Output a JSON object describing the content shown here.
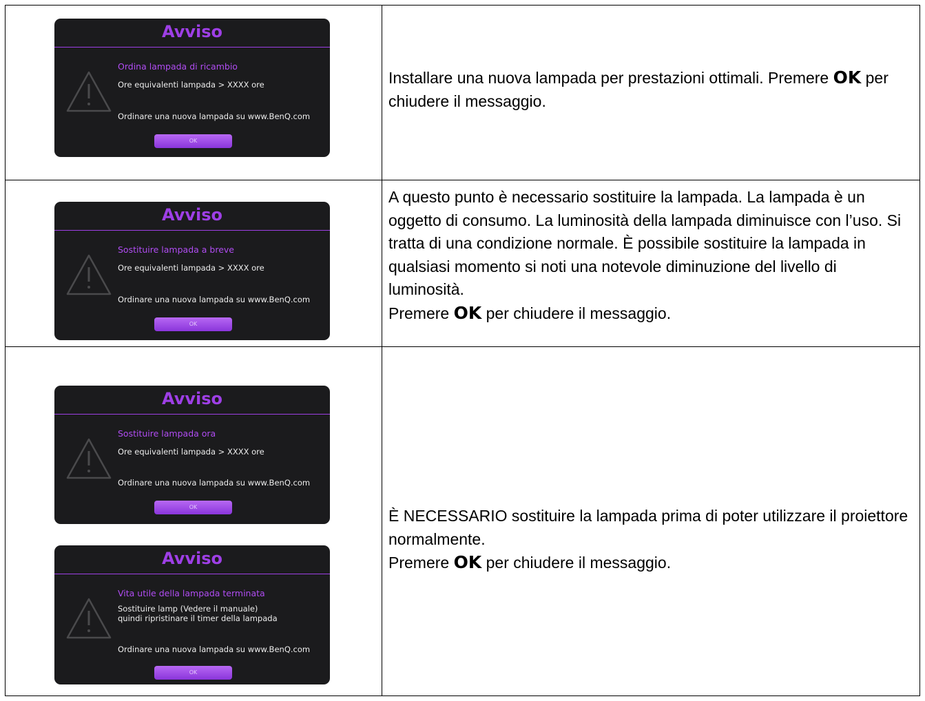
{
  "osd_icon": "warning-triangle-icon",
  "colors": {
    "dialog_bg": "#1b1b1d",
    "accent_purple": "#9e3fe6",
    "button_purple": "#a856ee"
  },
  "rows": [
    {
      "dialogs": [
        {
          "title": "Avviso",
          "heading": "Ordina lampada di ricambio",
          "line1": "Ore equivalenti lampada > XXXX ore",
          "url_line": "Ordinare una nuova lampada su www.BenQ.com",
          "ok": "OK"
        }
      ],
      "desc": {
        "p1_text": "Installare una nuova lampada per prestazioni ottimali. Premere ",
        "p1_ok": "OK",
        "p1_after": " per chiudere il messaggio."
      }
    },
    {
      "dialogs": [
        {
          "title": "Avviso",
          "heading": "Sostituire lampada a breve",
          "line1": "Ore equivalenti lampada > XXXX ore",
          "url_line": "Ordinare una nuova lampada su www.BenQ.com",
          "ok": "OK"
        }
      ],
      "desc": {
        "p1_text": "A questo punto è necessario sostituire la lampada. La lampada è un oggetto di consumo. La luminosità della lampada diminuisce con l’uso. Si tratta di una condizione normale. È possibile sostituire la lampada in qualsiasi momento si noti una notevole diminuzione del livello di luminosità.",
        "p2_text": "Premere ",
        "p2_ok": "OK",
        "p2_after": " per chiudere il messaggio."
      }
    },
    {
      "dialogs": [
        {
          "title": "Avviso",
          "heading": "Sostituire lampada ora",
          "line1": "Ore equivalenti lampada > XXXX ore",
          "url_line": "Ordinare una nuova lampada su www.BenQ.com",
          "ok": "OK"
        },
        {
          "title": "Avviso",
          "heading": "Vita utile della lampada terminata",
          "line1": "Sostituire lamp (Vedere il manuale)\nquindi ripristinare il timer della lampada",
          "url_line": "Ordinare una nuova lampada su www.BenQ.com",
          "ok": "OK"
        }
      ],
      "desc": {
        "p1_text": "È NECESSARIO sostituire la lampada prima di poter utilizzare il proiettore normalmente.",
        "p2_text": "Premere ",
        "p2_ok": "OK",
        "p2_after": " per chiudere il messaggio."
      }
    }
  ]
}
